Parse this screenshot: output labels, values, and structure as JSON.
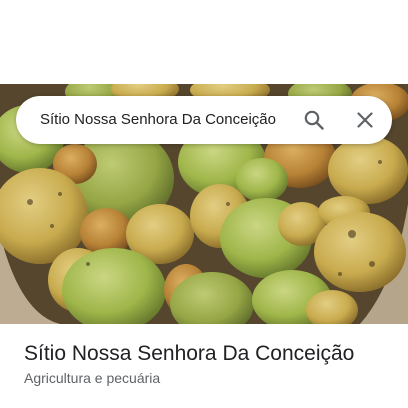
{
  "search": {
    "query": "Sítio Nossa Senhora Da Conceição"
  },
  "icons": {
    "search": "search-icon",
    "close": "close-icon"
  },
  "place": {
    "title": "Sítio Nossa Senhora Da Conceição",
    "category": "Agricultura e pecuária"
  },
  "colors": {
    "title_text": "#202124",
    "secondary_text": "#5f6368",
    "icon": "#5f6368"
  }
}
